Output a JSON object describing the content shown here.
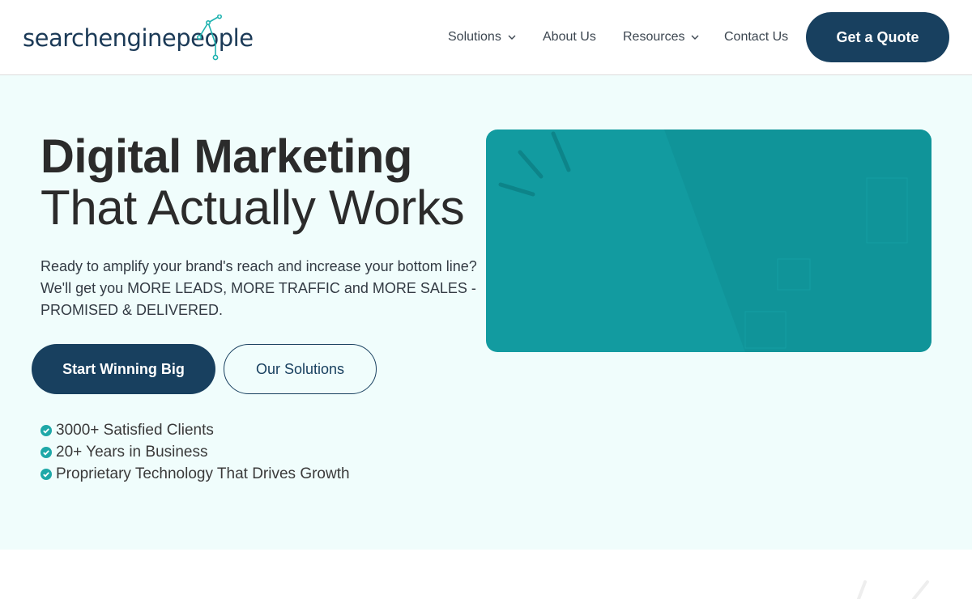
{
  "brand": {
    "logo_text": "searchenginepeople",
    "accent": "#18405f",
    "teal": "#1fb3b0",
    "hero_bg": "#f0fdfc"
  },
  "nav": {
    "items": [
      {
        "label": "Solutions",
        "has_dropdown": true,
        "icon": "chevron-down-icon"
      },
      {
        "label": "About Us",
        "has_dropdown": false
      },
      {
        "label": "Resources",
        "has_dropdown": true,
        "icon": "chevron-down-icon"
      },
      {
        "label": "Contact Us",
        "has_dropdown": false
      }
    ],
    "cta": "Get a Quote"
  },
  "hero": {
    "title_line1": "Digital Marketing",
    "title_line2": "That Actually Works",
    "lead": "Ready to amplify your brand's reach and increase your bottom line? We'll get you MORE LEADS, MORE TRAFFIC and MORE SALES - PROMISED & DELIVERED.",
    "primary_button": "Start Winning Big",
    "secondary_button": "Our Solutions",
    "checklist": [
      "3000+ Satisfied Clients",
      "20+ Years in Business",
      "Proprietary Technology That Drives Growth"
    ],
    "check_icon": "check-circle-icon",
    "media_color": "#129ba0"
  }
}
